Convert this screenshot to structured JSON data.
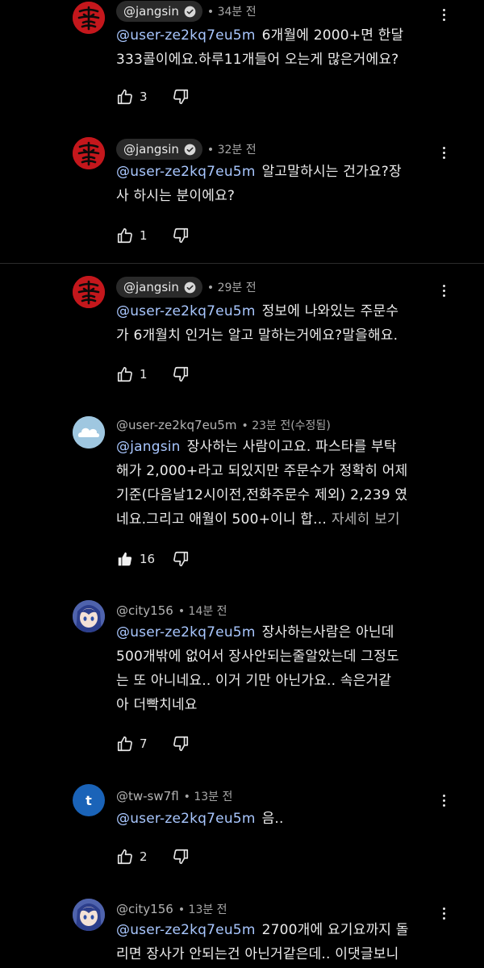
{
  "comments": [
    {
      "author": "@jangsin",
      "time": "34분 전",
      "mention": "@user-ze2kq7eu5m",
      "lines": [
        "6개월에 2000+면 한달",
        "333콜이에요.하루11개들어 오는게 많은거에요?"
      ],
      "likes": "3",
      "liked": false
    },
    {
      "author": "@jangsin",
      "time": "32분 전",
      "mention": "@user-ze2kq7eu5m",
      "lines": [
        "알고말하시는 건가요?장",
        "사 하시는 분이에요?"
      ],
      "likes": "1",
      "liked": false
    },
    {
      "author": "@jangsin",
      "time": "29분 전",
      "mention": "@user-ze2kq7eu5m",
      "lines": [
        "정보에 나와있는 주문수",
        "가 6개월치 인거는 알고 말하는거에요?말을해요."
      ],
      "likes": "1",
      "liked": false
    },
    {
      "author": "@user-ze2kq7eu5m",
      "time": "23분 전(수정됨)",
      "mention": "@jangsin",
      "lines": [
        "장사하는 사람이고요. 파스타를 부탁",
        "해가 2,000+라고 되있지만 주문수가 정확히 어제",
        "기준(다음날12시이전,전화주문수 제외) 2,239 였",
        "네요.그리고 애월이 500+이니 합..."
      ],
      "more": "자세히 보기",
      "likes": "16",
      "liked": true
    },
    {
      "author": "@city156",
      "time": "14분 전",
      "mention": "@user-ze2kq7eu5m",
      "lines": [
        "장사하는사람은 아닌데",
        "500개밖에 없어서 장사안되는줄알았는데 그정도",
        "는 또 아니네요.. 이거 기만 아닌가요.. 속은거같",
        "아 더빡치네요"
      ],
      "likes": "7",
      "liked": false
    },
    {
      "author": "@tw-sw7fl",
      "time": "13분 전",
      "avatar_letter": "t",
      "mention": "@user-ze2kq7eu5m",
      "lines": [
        "음.."
      ],
      "likes": "2",
      "liked": false
    },
    {
      "author": "@city156",
      "time": "13분 전",
      "mention": "@user-ze2kq7eu5m",
      "lines": [
        "2700개에 요기요까지 돌",
        "리면 장사가 안되는건 아닌거같은데.. 이댓글보니"
      ],
      "likes": "",
      "liked": false
    }
  ],
  "separator": "•",
  "icons": {
    "like": "thumbs-up-icon",
    "dislike": "thumbs-down-icon",
    "menu": "more-vert-icon",
    "verified": "verified-check-icon"
  },
  "colors": {
    "background": "#000000",
    "mention": "#a9c7ff",
    "chip": "#2a2a2a",
    "mark_avatar": "#c4171c",
    "letter_avatar": "#1a63b8"
  }
}
